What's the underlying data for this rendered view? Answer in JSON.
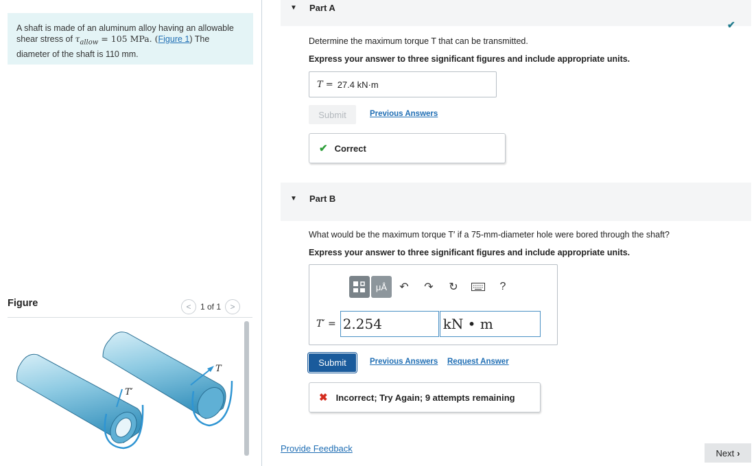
{
  "problem": {
    "text_part1": "A shaft is made of an aluminum alloy having an allowable shear stress of ",
    "symbol_tau": "τ",
    "subscript": "allow",
    "text_equals": " = 105 MPa. (",
    "figure_link": "Figure 1",
    "text_part2": ") The diameter of the shaft is 110 mm."
  },
  "figure": {
    "title": "Figure",
    "pager_text": "1 of 1",
    "label_T": "T",
    "label_Tprime": "T′"
  },
  "partA": {
    "header": "Part A",
    "question": "Determine the maximum torque T that can be transmitted.",
    "instructions": "Express your answer to three significant figures and include appropriate units.",
    "answer_label": "T =",
    "answer_value": "27.4 kN·m",
    "submit_label": "Submit",
    "previous_answers": "Previous Answers",
    "feedback": "Correct",
    "status": "complete"
  },
  "partB": {
    "header": "Part B",
    "question": "What would be the maximum torque T′ if a 75-mm-diameter hole were bored through the shaft?",
    "instructions": "Express your answer to three significant figures and include appropriate units.",
    "input_label": "T′ =",
    "input_value": "2.254",
    "unit_value": "kN • m",
    "toolbar_help": "?",
    "toolbar_muA": "μÅ",
    "submit_label": "Submit",
    "previous_answers": "Previous Answers",
    "request_answer": "Request Answer",
    "feedback": "Incorrect; Try Again; 9 attempts remaining"
  },
  "footer": {
    "provide_feedback": "Provide Feedback",
    "next_label": "Next"
  },
  "colors": {
    "problem_bg": "#e4f4f6",
    "link": "#1f6eb4",
    "submit": "#1a5b9c",
    "correct_green": "#2e9e3a",
    "incorrect_red": "#d42c1e"
  }
}
